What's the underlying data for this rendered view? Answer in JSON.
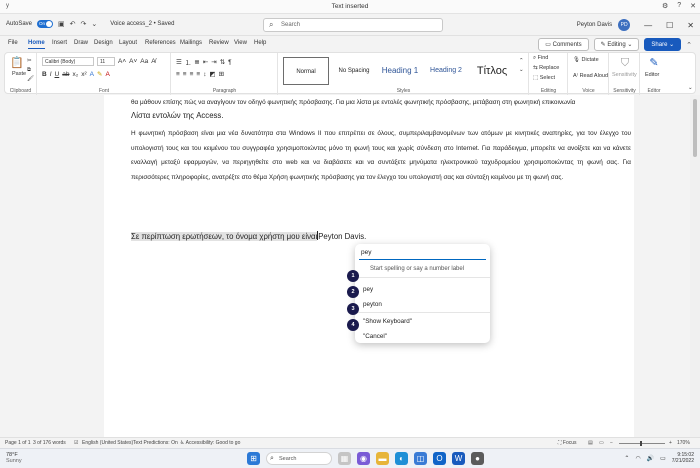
{
  "notification": {
    "app": "y",
    "title": "Text inserted"
  },
  "titlebar": {
    "autosave_label": "AutoSave",
    "autosave_state": "On",
    "doc_name": "Voice access_2 • Saved",
    "search_placeholder": "Search",
    "user_name": "Peyton Davis",
    "user_initials": "PD"
  },
  "tabs": [
    "File",
    "Home",
    "Insert",
    "Draw",
    "Design",
    "Layout",
    "References",
    "Mailings",
    "Review",
    "View",
    "Help"
  ],
  "active_tab": "Home",
  "ribbon_actions": {
    "comments": "Comments",
    "editing": "Editing",
    "share": "Share"
  },
  "ribbon": {
    "clipboard": {
      "paste": "Paste",
      "label": "Clipboard"
    },
    "font": {
      "name": "Calibri (Body)",
      "size": "11",
      "label": "Font"
    },
    "paragraph": {
      "label": "Paragraph"
    },
    "styles": {
      "items": [
        "Normal",
        "No Spacing",
        "Heading 1",
        "Heading 2",
        "Τίτλος"
      ],
      "label": "Styles"
    },
    "editing": {
      "find": "Find",
      "replace": "Replace",
      "select": "Select",
      "label": "Editing"
    },
    "voice": {
      "dictate": "Dictate",
      "read_aloud": "Read Aloud",
      "label": "Voice"
    },
    "sensitivity": {
      "label": "Sensitivity"
    },
    "editor": {
      "label": "Editor"
    }
  },
  "document": {
    "line1": "θα μάθουν επίσης πώς να αναγίγουν τον οδηγό φωνητικής πρόσβασης. Για μια λίστα με εντολές φωνητικής πρόσβασης, μετάβαση στη φωνητική επικοινωνία",
    "line2": "Λίστα εντολών της Access.",
    "para2": "Η φωνητική πρόσβαση είναι μια νέα δυνατότητα στα Windows II που επιτρέπει σε όλους, συμπεριλαμβανομένων των ατόμων με κινητικές αναπηρίες, για τον έλεγχο του υπολογιστή τους και του κειμένου του συγγραφέα χρησιμοποιώντας μόνο τη φωνή τους και χωρίς σύνδεση στο Internet. Για παράδειγμα, μπορείτε να ανοίξετε και να κάνετε εναλλαγή μεταξύ εφαρμογών, να περιηγηθείτε στο web και να διαβάσετε και να συντάξετε μηνύματα ηλεκτρονικού ταχυδρομείου χρησιμοποιώντας τη φωνή σας. Για περισσότερες πληροφορίες, ανατρέξτε στο θέμα Χρήση φωνητικής πρόσβασης για τον έλεγχο του υπολογιστή σας και σύνταξη κειμένου με τη φωνή σας.",
    "inserted_line": "Σε περίπτωση ερωτήσεων, το όνομα χρήστη μου είναι",
    "inserted_name": "Peyton Davis."
  },
  "voice_popup": {
    "input_value": "pey",
    "hint": "Start spelling or say a number label",
    "options": [
      {
        "number": "1",
        "label": ""
      },
      {
        "number": "2",
        "label": "pey"
      },
      {
        "number": "3",
        "label": "peyton"
      },
      {
        "number": "4",
        "label": "\"Show Keyboard\""
      },
      {
        "number": "",
        "label": "\"Cancel\""
      }
    ]
  },
  "statusbar": {
    "page": "Page 1 of 1",
    "words": "3 of 176 words",
    "language": "English (United States)",
    "predictions": "Text Predictions: On",
    "accessibility": "Accessibility: Good to go",
    "focus": "Focus",
    "zoom": "170%"
  },
  "taskbar": {
    "temp": "78°F",
    "weather": "Sunny",
    "search": "Search",
    "time": "9:15:02",
    "date": "7/21/2022"
  },
  "colors": {
    "accent": "#185abd",
    "toggle": "#1f6fd1",
    "badge": "#1a1a4d",
    "popup_underline": "#0067c0"
  }
}
